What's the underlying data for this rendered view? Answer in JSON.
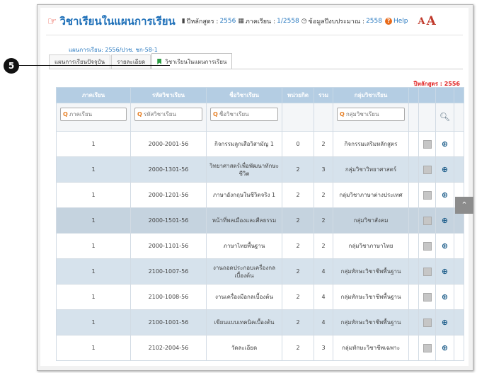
{
  "header": {
    "title": "วิชาเรียนในแผนการเรียน",
    "curriculum_year_label": "ปีหลักสูตร :",
    "curriculum_year": "2556",
    "semester_label": "ภาคเรียน :",
    "semester": "1/2558",
    "budget_label": "ข้อมูลปีงบประมาณ :",
    "budget_year": "2558",
    "help": "Help",
    "font_small": "A",
    "font_large": "A"
  },
  "plan": {
    "label": "แผนการเรียน:",
    "value": "2556/ปวช. ชก-58-1"
  },
  "tabs": [
    {
      "label": "แผนการเรียนปัจจุบัน"
    },
    {
      "label": "รายละเอียด"
    },
    {
      "label": "วิชาเรียนในแผนการเรียน"
    }
  ],
  "year_badge": "ปีหลักสูตร : 2556",
  "table": {
    "headers": [
      "ภาคเรียน",
      "รหัสวิชาเรียน",
      "ชื่อวิชาเรียน",
      "หน่วยกิต",
      "รวม",
      "กลุ่มวิชาเรียน"
    ],
    "filters": {
      "semester": "ภาคเรียน",
      "code": "รหัสวิชาเรียน",
      "name": "ชื่อวิชาเรียน",
      "group": "กลุ่มวิชาเรียน"
    },
    "rows": [
      {
        "semester": "1",
        "code": "2000-2001-56",
        "name": "กิจกรรมลูกเสือวิสามัญ 1",
        "credits": "0",
        "total": "2",
        "group": "กิจกรรมเสริมหลักสูตร"
      },
      {
        "semester": "1",
        "code": "2000-1301-56",
        "name": "วิทยาศาสตร์เพื่อพัฒนาทักษะชีวิต",
        "credits": "2",
        "total": "3",
        "group": "กลุ่มวิชาวิทยาศาสตร์"
      },
      {
        "semester": "1",
        "code": "2000-1201-56",
        "name": "ภาษาอังกฤษในชีวิตจริง 1",
        "credits": "2",
        "total": "2",
        "group": "กลุ่มวิชาภาษาต่างประเทศ"
      },
      {
        "semester": "1",
        "code": "2000-1501-56",
        "name": "หน้าที่พลเมืองและศีลธรรม",
        "credits": "2",
        "total": "2",
        "group": "กลุ่มวิชาสังคม"
      },
      {
        "semester": "1",
        "code": "2000-1101-56",
        "name": "ภาษาไทยพื้นฐาน",
        "credits": "2",
        "total": "2",
        "group": "กลุ่มวิชาภาษาไทย"
      },
      {
        "semester": "1",
        "code": "2100-1007-56",
        "name": "งานถอดประกอบเครื่องกลเบื้องต้น",
        "credits": "2",
        "total": "4",
        "group": "กลุ่มทักษะวิชาชีพพื้นฐาน"
      },
      {
        "semester": "1",
        "code": "2100-1008-56",
        "name": "งานเครื่องมือกลเบื้องต้น",
        "credits": "2",
        "total": "4",
        "group": "กลุ่มทักษะวิชาชีพพื้นฐาน"
      },
      {
        "semester": "1",
        "code": "2100-1001-56",
        "name": "เขียนแบบเทคนิคเบื้องต้น",
        "credits": "2",
        "total": "4",
        "group": "กลุ่มทักษะวิชาชีพพื้นฐาน"
      },
      {
        "semester": "1",
        "code": "2102-2004-56",
        "name": "วัดละเอียด",
        "credits": "2",
        "total": "3",
        "group": "กลุ่มทักษะวิชาชีพเฉพาะ"
      }
    ]
  },
  "annotation": {
    "step": "5"
  }
}
